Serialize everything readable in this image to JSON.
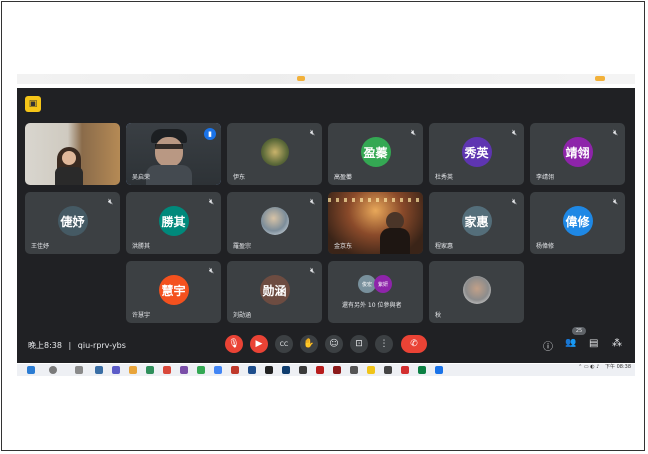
{
  "meeting": {
    "time": "晚上8:38",
    "separator": "|",
    "code": "qiu-rprv-ybs"
  },
  "participants": [
    {
      "name": "",
      "initials": "",
      "type": "self-video"
    },
    {
      "name": "吴启荣",
      "initials": "",
      "type": "camera",
      "speaking": true
    },
    {
      "name": "伊东",
      "initials": "",
      "type": "photo"
    },
    {
      "name": "高盈蓁",
      "initials": "盈蓁",
      "color": "#34a853"
    },
    {
      "name": "杜秀英",
      "initials": "秀英",
      "color": "#5e35b1"
    },
    {
      "name": "李靖翎",
      "initials": "靖翎",
      "color": "#8e24aa"
    },
    {
      "name": "王佳妤",
      "initials": "倢妤",
      "color": "#455a64"
    },
    {
      "name": "洪勝其",
      "initials": "勝其",
      "color": "#00897b"
    },
    {
      "name": "羅盈宗",
      "initials": "",
      "type": "photo"
    },
    {
      "name": "金京东",
      "initials": "",
      "type": "video-bar"
    },
    {
      "name": "程家惠",
      "initials": "家惠",
      "color": "#546e7a"
    },
    {
      "name": "杨偉修",
      "initials": "偉修",
      "color": "#1e88e5"
    },
    {
      "name": "许慧宇",
      "initials": "慧宇",
      "color": "#f4511e"
    },
    {
      "name": "刘勋涵",
      "initials": "勋涵",
      "color": "#6d4c41"
    },
    {
      "name": "還有另外 10 位參與者",
      "initials": "",
      "type": "others",
      "chips": [
        "俊宏",
        "紫妍"
      ]
    },
    {
      "name": "秋",
      "initials": "",
      "type": "photo"
    }
  ],
  "controls": {
    "mic": "mic-off",
    "camera": "camera-off",
    "captions": "CC",
    "raise_hand": "✋",
    "emoji": "☺",
    "present": "⊡",
    "more": "⋮",
    "hangup": "✆"
  },
  "right_panel": {
    "info": "ⓘ",
    "people_count": "25",
    "people": "👥",
    "chat": "▤",
    "activities": "⁂"
  },
  "taskbar": {
    "clock": "下午 08:38",
    "tray": "⌃ ▭ ◐ ♪"
  },
  "colors": {
    "background": "#202124",
    "tile": "#3c4043",
    "accent": "#8ab4f8",
    "hangup": "#ea4335"
  }
}
